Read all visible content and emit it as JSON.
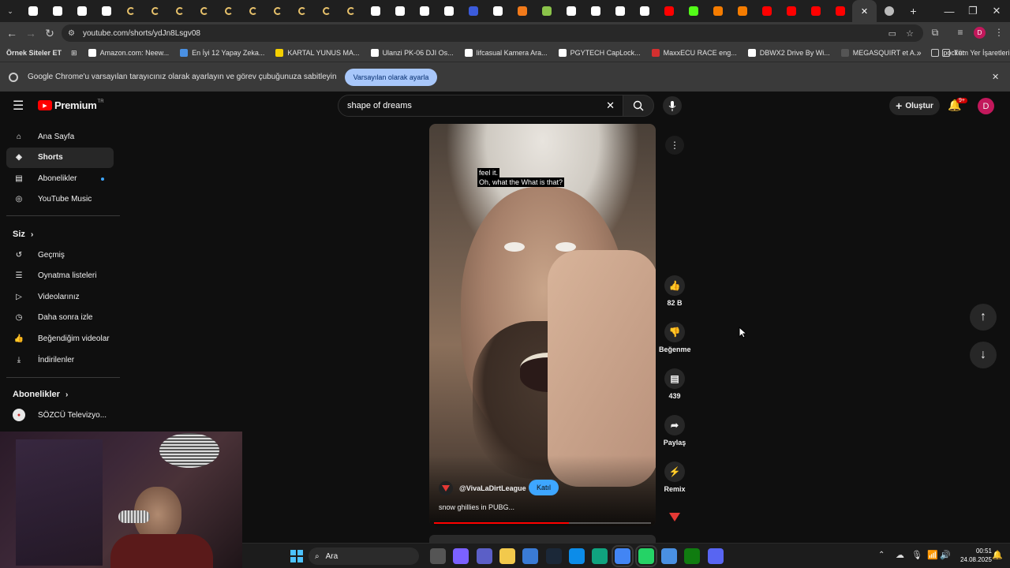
{
  "browser": {
    "tab_favicons": [
      {
        "icon": "amazon-icon",
        "color": "#ffffff"
      },
      {
        "icon": "amazon-icon",
        "color": "#ffffff"
      },
      {
        "icon": "amazon-icon",
        "color": "#ffffff"
      },
      {
        "icon": "amazon-icon",
        "color": "#ffffff"
      },
      {
        "icon": "loading-icon",
        "color": "#e8c26b"
      },
      {
        "icon": "loading-icon",
        "color": "#e8c26b"
      },
      {
        "icon": "loading-icon",
        "color": "#e8c26b"
      },
      {
        "icon": "loading-icon",
        "color": "#e8c26b"
      },
      {
        "icon": "loading-icon",
        "color": "#e8c26b"
      },
      {
        "icon": "loading-icon",
        "color": "#e8c26b"
      },
      {
        "icon": "loading-icon",
        "color": "#e8c26b"
      },
      {
        "icon": "loading-icon",
        "color": "#e8c26b"
      },
      {
        "icon": "loading-icon",
        "color": "#e8c26b"
      },
      {
        "icon": "loading-icon",
        "color": "#e8c26b"
      },
      {
        "icon": "amazon-icon",
        "color": "#ffffff"
      },
      {
        "icon": "amazon-icon",
        "color": "#ffffff"
      },
      {
        "icon": "amazon-icon",
        "color": "#ffffff"
      },
      {
        "icon": "google-icon",
        "color": "#ffffff"
      },
      {
        "icon": "r-icon",
        "color": "#3b5bdb"
      },
      {
        "icon": "google-icon",
        "color": "#ffffff"
      },
      {
        "icon": "hb-icon",
        "color": "#f27a1a"
      },
      {
        "icon": "app-icon",
        "color": "#8bc34a"
      },
      {
        "icon": "google-icon",
        "color": "#ffffff"
      },
      {
        "icon": "amazon-icon",
        "color": "#ffffff"
      },
      {
        "icon": "amazon-icon",
        "color": "#ffffff"
      },
      {
        "icon": "amazon-icon",
        "color": "#ffffff"
      },
      {
        "icon": "youtube-icon",
        "color": "#ff0000"
      },
      {
        "icon": "kick-icon",
        "color": "#53fc18"
      },
      {
        "icon": "orange-icon",
        "color": "#f57c00"
      },
      {
        "icon": "orange-icon",
        "color": "#f57c00"
      },
      {
        "icon": "youtube-icon",
        "color": "#ff0000"
      },
      {
        "icon": "youtube-icon",
        "color": "#ff0000"
      },
      {
        "icon": "youtube-icon",
        "color": "#ff0000"
      },
      {
        "icon": "youtube-icon",
        "color": "#ff0000"
      }
    ],
    "url": "youtube.com/shorts/ydJn8Lsgv08",
    "bookmarks": [
      {
        "label": "Örnek Siteler ET",
        "color": "#3a3a3a"
      },
      {
        "label": "Amazon.com: Neew...",
        "color": "#ffffff"
      },
      {
        "label": "En İyi 12 Yapay Zeka...",
        "color": "#4a90e2"
      },
      {
        "label": "KARTAL YUNUS MA...",
        "color": "#f5d000"
      },
      {
        "label": "Ulanzi PK-06 DJI Os...",
        "color": "#ffffff"
      },
      {
        "label": "lifcasual Kamera Ara...",
        "color": "#ffffff"
      },
      {
        "label": "PGYTECH CapLock...",
        "color": "#ffffff"
      },
      {
        "label": "MaxxECU RACE eng...",
        "color": "#d32f2f"
      },
      {
        "label": "DBWX2 Drive By Wi...",
        "color": "#ffffff"
      },
      {
        "label": "MEGASQUIRT et A...",
        "color": "#555555"
      },
      {
        "label": "pocket",
        "color": "#3a3a3a"
      }
    ],
    "all_bookmarks": "Tüm Yer İşaretleri",
    "infobar_text": "Google Chrome'u varsayılan tarayıcınız olarak ayarlayın ve görev çubuğunuza sabitleyin",
    "infobar_button": "Varsayılan olarak ayarla",
    "profile_initial": "D"
  },
  "youtube": {
    "logo": "Premium",
    "logo_country": "TR",
    "search_value": "shape of dreams",
    "create_label": "Oluştur",
    "notif_badge": "9+",
    "avatar_initial": "D",
    "nav_main": [
      {
        "label": "Ana Sayfa",
        "icon": "home-icon"
      },
      {
        "label": "Shorts",
        "icon": "shorts-icon"
      },
      {
        "label": "Abonelikler",
        "icon": "subscriptions-icon"
      },
      {
        "label": "YouTube Music",
        "icon": "music-icon"
      }
    ],
    "you_header": "Siz",
    "nav_you": [
      {
        "label": "Geçmiş",
        "icon": "history-icon"
      },
      {
        "label": "Oynatma listeleri",
        "icon": "playlists-icon"
      },
      {
        "label": "Videolarınız",
        "icon": "your-videos-icon"
      },
      {
        "label": "Daha sonra izle",
        "icon": "watch-later-icon"
      },
      {
        "label": "Beğendiğim videolar",
        "icon": "liked-icon"
      },
      {
        "label": "İndirilenler",
        "icon": "download-icon"
      }
    ],
    "subs_header": "Abonelikler",
    "subs": [
      {
        "label": "SÖZCÜ Televizyo...",
        "icon": "sozcu-avatar"
      }
    ],
    "short": {
      "caption_line1": "feel it.",
      "caption_line2": "Oh, what the What is that?",
      "channel": "@VivaLaDirtLeague",
      "join_label": "Katıl",
      "title": "snow ghillies in PUBG...",
      "progress": 0.62
    },
    "actions": [
      {
        "label": "82 B",
        "icon": "like-icon"
      },
      {
        "label": "Beğenme",
        "icon": "dislike-icon"
      },
      {
        "label": "439",
        "icon": "comment-icon"
      },
      {
        "label": "Paylaş",
        "icon": "share-icon"
      },
      {
        "label": "Remix",
        "icon": "remix-icon"
      }
    ]
  },
  "taskbar": {
    "search_label": "Ara",
    "time": "00:51",
    "date": "24.08.2025"
  }
}
